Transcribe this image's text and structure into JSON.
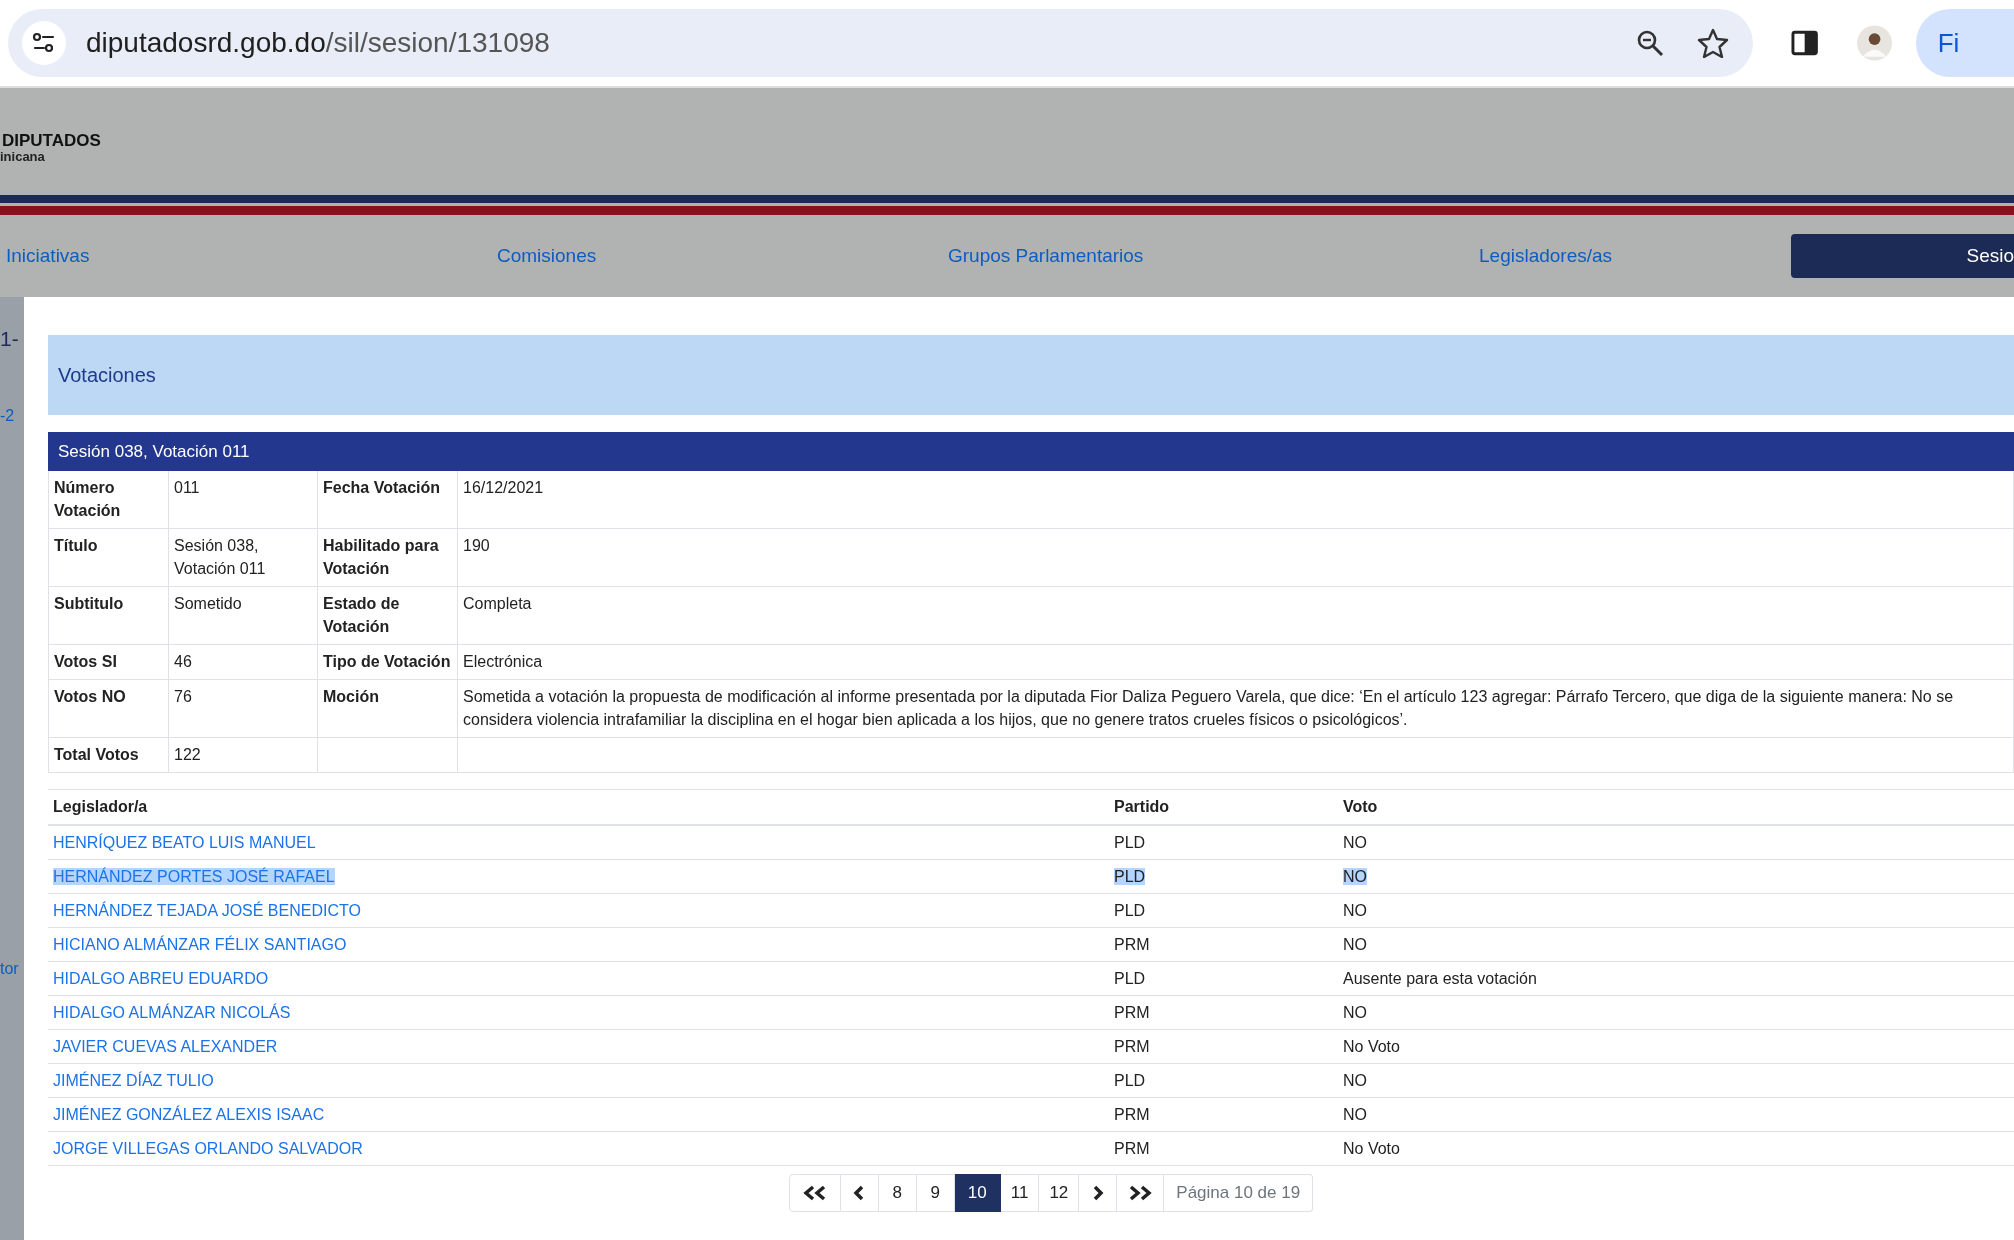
{
  "browser": {
    "url_host": "diputadosrd.gob.do",
    "url_path": "/sil/sesion/131098",
    "profile_button": "Fi"
  },
  "site": {
    "logo_line1": "DIPUTADOS",
    "logo_line2": "inicana",
    "nav": [
      {
        "label": "Iniciativas",
        "selected": false
      },
      {
        "label": "Comisiones",
        "selected": false
      },
      {
        "label": "Grupos Parlamentarios",
        "selected": false
      },
      {
        "label": "Legisladores/as",
        "selected": false
      },
      {
        "label": "Sesio",
        "selected": true
      }
    ],
    "background_fragments": [
      "1-",
      "-2",
      "tor"
    ]
  },
  "modal": {
    "title": "Votaciones",
    "section_title": "Sesión 038, Votación 011",
    "details": [
      {
        "label1": "Número Votación",
        "value1": "011",
        "label2": "Fecha Votación",
        "value2": "16/12/2021"
      },
      {
        "label1": "Título",
        "value1": "Sesión 038, Votación 011",
        "label2": "Habilitado para Votación",
        "value2": "190"
      },
      {
        "label1": "Subtitulo",
        "value1": "Sometido",
        "label2": "Estado de Votación",
        "value2": "Completa"
      },
      {
        "label1": "Votos SI",
        "value1": "46",
        "label2": "Tipo de Votación",
        "value2": "Electrónica"
      },
      {
        "label1": "Votos NO",
        "value1": "76",
        "label2": "Moción",
        "value2": "Sometida a votación la propuesta de modificación al informe presentada por la diputada Fior Daliza Peguero Varela, que dice: ‘En el artículo 123 agregar: Párrafo Tercero, que diga de la siguiente manera: No se considera violencia intrafamiliar la disciplina en el hogar bien aplicada a los hijos, que no genere tratos crueles físicos o psicológicos’."
      },
      {
        "label1": "Total Votos",
        "value1": "122"
      }
    ],
    "votes": {
      "columns": [
        "Legislador/a",
        "Partido",
        "Voto"
      ],
      "rows": [
        {
          "name": "HENRÍQUEZ BEATO LUIS MANUEL",
          "party": "PLD",
          "vote": "NO",
          "selected": false
        },
        {
          "name": "HERNÁNDEZ PORTES JOSÉ RAFAEL",
          "party": "PLD",
          "vote": "NO",
          "selected": true
        },
        {
          "name": "HERNÁNDEZ TEJADA JOSÉ BENEDICTO",
          "party": "PLD",
          "vote": "NO",
          "selected": false
        },
        {
          "name": "HICIANO ALMÁNZAR FÉLIX SANTIAGO",
          "party": "PRM",
          "vote": "NO",
          "selected": false
        },
        {
          "name": "HIDALGO ABREU EDUARDO",
          "party": "PLD",
          "vote": "Ausente para esta votación",
          "selected": false
        },
        {
          "name": "HIDALGO ALMÁNZAR NICOLÁS",
          "party": "PRM",
          "vote": "NO",
          "selected": false
        },
        {
          "name": "JAVIER CUEVAS ALEXANDER",
          "party": "PRM",
          "vote": "No Voto",
          "selected": false
        },
        {
          "name": "JIMÉNEZ DÍAZ TULIO",
          "party": "PLD",
          "vote": "NO",
          "selected": false
        },
        {
          "name": "JIMÉNEZ GONZÁLEZ ALEXIS ISAAC",
          "party": "PRM",
          "vote": "NO",
          "selected": false
        },
        {
          "name": "JORGE VILLEGAS ORLANDO SALVADOR",
          "party": "PRM",
          "vote": "No Voto",
          "selected": false
        }
      ]
    },
    "pagination": {
      "pages": [
        {
          "label": "8",
          "selected": false
        },
        {
          "label": "9",
          "selected": false
        },
        {
          "label": "10",
          "selected": true
        },
        {
          "label": "11",
          "selected": false
        },
        {
          "label": "12",
          "selected": false
        }
      ],
      "info": "Página 10 de 19"
    }
  }
}
